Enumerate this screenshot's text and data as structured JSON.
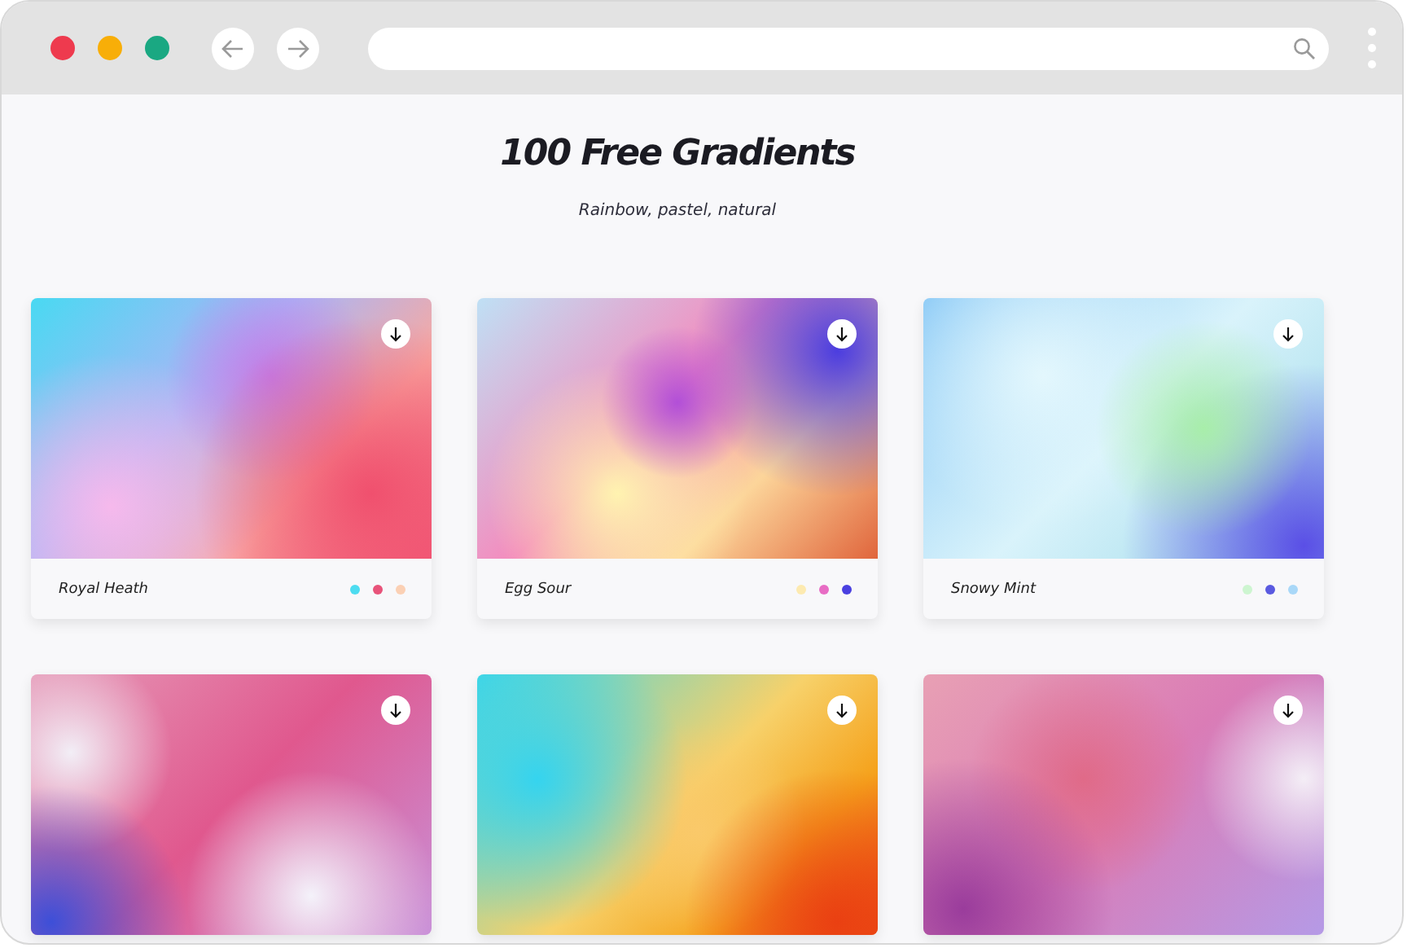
{
  "page": {
    "title": "100 Free Gradients",
    "subtitle": "Rainbow, pastel, natural"
  },
  "cards": [
    {
      "kind": "captioned",
      "name": "Royal Heath",
      "swatches": [
        {
          "color": "#4ddcf0"
        },
        {
          "color": "#e8537a"
        },
        {
          "color": "#fbd0b4"
        }
      ]
    },
    {
      "kind": "captioned",
      "name": "Egg Sour",
      "swatches": [
        {
          "color": "#fdeab0"
        },
        {
          "color": "#e86cc4"
        },
        {
          "color": "#4a40e0"
        }
      ]
    },
    {
      "kind": "captioned",
      "name": "Snowy Mint",
      "swatches": [
        {
          "color": "#cdf5d0"
        },
        {
          "color": "#5a5ae0"
        },
        {
          "color": "#a9d8f8"
        }
      ]
    },
    {
      "kind": "preview_only"
    },
    {
      "kind": "preview_only"
    },
    {
      "kind": "preview_only"
    }
  ]
}
